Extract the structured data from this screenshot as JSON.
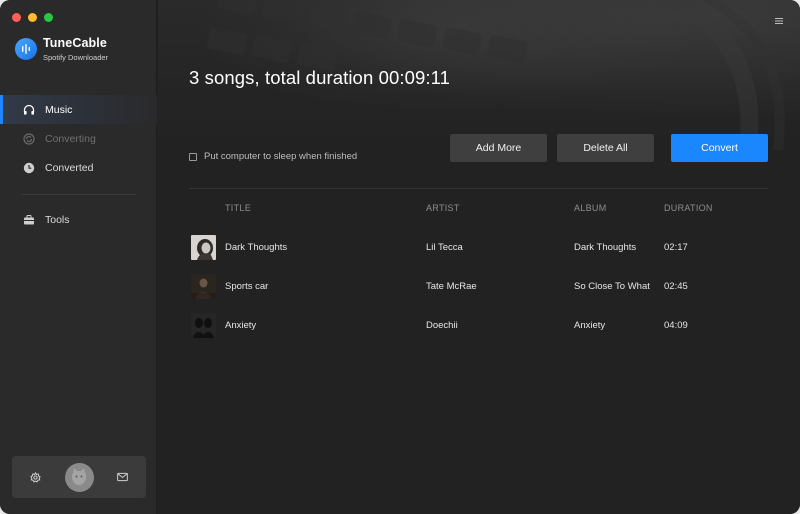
{
  "app": {
    "name": "TuneCable",
    "subtitle": "Spotify Downloader"
  },
  "sidebar": {
    "items": [
      {
        "label": "Music",
        "icon": "headphones-icon",
        "state": "active"
      },
      {
        "label": "Converting",
        "icon": "converting-icon",
        "state": "disabled"
      },
      {
        "label": "Converted",
        "icon": "clock-icon",
        "state": "normal"
      },
      {
        "label": "Tools",
        "icon": "toolbox-icon",
        "state": "normal"
      }
    ],
    "footer": {
      "settings_icon": "gear-icon",
      "avatar_icon": "avatar-icon",
      "mail_icon": "mail-icon"
    }
  },
  "main": {
    "summary": "3 songs, total duration 00:09:11",
    "sleep_option": {
      "label": "Put computer to sleep when finished",
      "checked": false
    },
    "buttons": {
      "add_more": "Add More",
      "delete_all": "Delete All",
      "convert": "Convert"
    },
    "table": {
      "headers": {
        "title": "TITLE",
        "artist": "ARTIST",
        "album": "ALBUM",
        "duration": "DURATION"
      },
      "rows": [
        {
          "title": "Dark Thoughts",
          "artist": "Lil Tecca",
          "album": "Dark Thoughts",
          "duration": "02:17"
        },
        {
          "title": "Sports car",
          "artist": "Tate McRae",
          "album": "So Close To What",
          "duration": "02:45"
        },
        {
          "title": "Anxiety",
          "artist": "Doechii",
          "album": "Anxiety",
          "duration": "04:09"
        }
      ]
    }
  },
  "colors": {
    "accent": "#1a86ff",
    "sidebar_bg": "#2a2a2a",
    "main_bg": "#222222",
    "button_bg": "#3f3f3f"
  }
}
